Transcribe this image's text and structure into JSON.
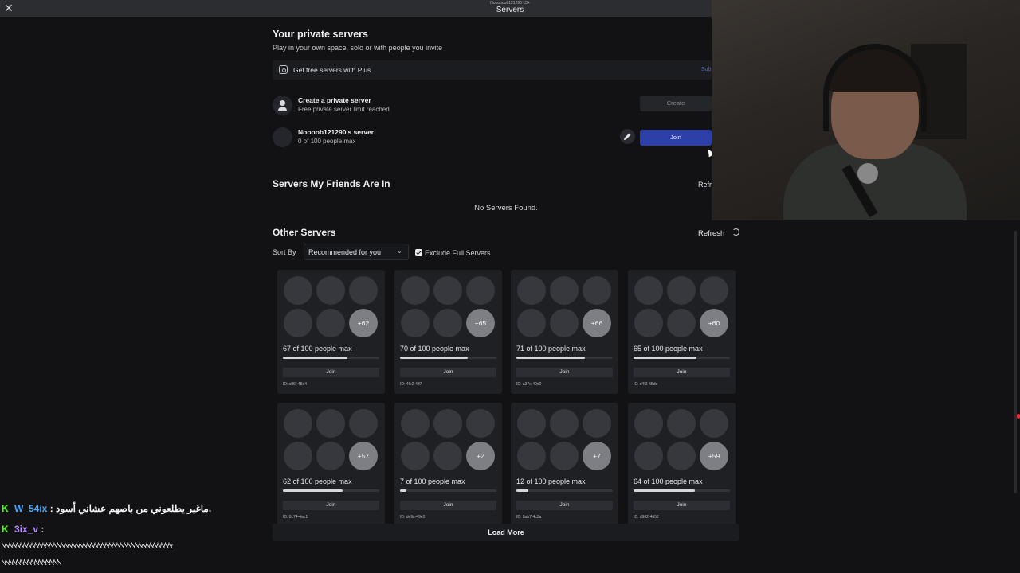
{
  "topbar": {
    "user": "Noooooob121290 13+",
    "title": "Servers"
  },
  "private": {
    "heading": "Your private servers",
    "subtitle": "Play in your own space, solo or with people you invite",
    "plus_text": "Get free servers with Plus",
    "plus_cta": "Sub",
    "create_title": "Create a private server",
    "create_sub": "Free private server limit reached",
    "create_button": "Create",
    "server_title": "Noooob121290's server",
    "server_sub": "0 of 100 people max",
    "join_button": "Join"
  },
  "friends": {
    "heading": "Servers My Friends Are In",
    "refresh": "Refr",
    "empty": "No Servers Found."
  },
  "other": {
    "heading": "Other Servers",
    "refresh": "Refresh",
    "sort_label": "Sort By",
    "sort_value": "Recommended for you",
    "exclude_label": "Exclude Full Servers",
    "exclude_checked": true
  },
  "servers": [
    {
      "more": "+62",
      "count": "67 of 100 people max",
      "fill": 0.67,
      "join": "Join",
      "id": "ID: c86f-48d4"
    },
    {
      "more": "+65",
      "count": "70 of 100 people max",
      "fill": 0.7,
      "join": "Join",
      "id": "ID: 4fe2-4ff7"
    },
    {
      "more": "+66",
      "count": "71 of 100 people max",
      "fill": 0.71,
      "join": "Join",
      "id": "ID: a37c-49d0"
    },
    {
      "more": "+60",
      "count": "65 of 100 people max",
      "fill": 0.65,
      "join": "Join",
      "id": "ID: d4f3-45de"
    },
    {
      "more": "+57",
      "count": "62 of 100 people max",
      "fill": 0.62,
      "join": "Join",
      "id": "ID: 8c74-4ac1"
    },
    {
      "more": "+2",
      "count": "7 of 100 people max",
      "fill": 0.07,
      "join": "Join",
      "id": "ID: de9c-49e5"
    },
    {
      "more": "+7",
      "count": "12 of 100 people max",
      "fill": 0.12,
      "join": "Join",
      "id": "ID: 0ab7-4c2a"
    },
    {
      "more": "+59",
      "count": "64 of 100 people max",
      "fill": 0.64,
      "join": "Join",
      "id": "ID: d902-4652"
    }
  ],
  "load_more": "Load More",
  "chat": [
    {
      "user": "W_54ix",
      "text": " : ماغير يطلعوني من باصهم عشاني أسود."
    },
    {
      "user": "3ix_v",
      "text": " :"
    }
  ],
  "chat_spam": [
    "ﭏﭏﭏﭏﭏﭏﭏﭏﭏﭏﭏﭏﭏﭏﭏﭏﭏﭏﭏﭏﭏﭏﭏﭏﭏﭏﭏﭏﭏﭏﭏﭏﭏﭏﭏﭏﭏﭏﭏﭏﭏﭏﭏﭏﭏﭏ",
    "ﭏﭏﭏﭏﭏﭏﭏﭏﭏﭏﭏﭏﭏﭏﭏﭏ"
  ],
  "colors": {
    "join_primary": "#2c40a8",
    "plus_link": "#3b6cf0",
    "kick_green": "#53fc18"
  }
}
